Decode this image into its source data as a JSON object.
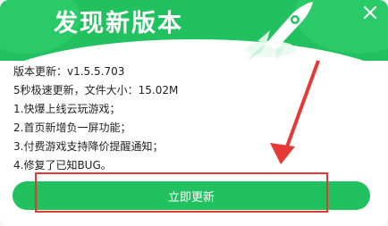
{
  "dialog": {
    "title": "发现新版本",
    "close_icon": "close-icon"
  },
  "update_info": {
    "version_line": "版本更新：v1.5.5.703",
    "size_line": "5秒极速更新，文件大小：15.02M",
    "items": [
      "1.快爆上线云玩游戏；",
      "2.首页新增负一屏功能；",
      "3.付费游戏支持降价提醒通知；",
      "4.修复了已知BUG。"
    ]
  },
  "actions": {
    "update_label": "立即更新"
  },
  "colors": {
    "brand_green": "#22c160",
    "annotation_red": "#e53935"
  }
}
